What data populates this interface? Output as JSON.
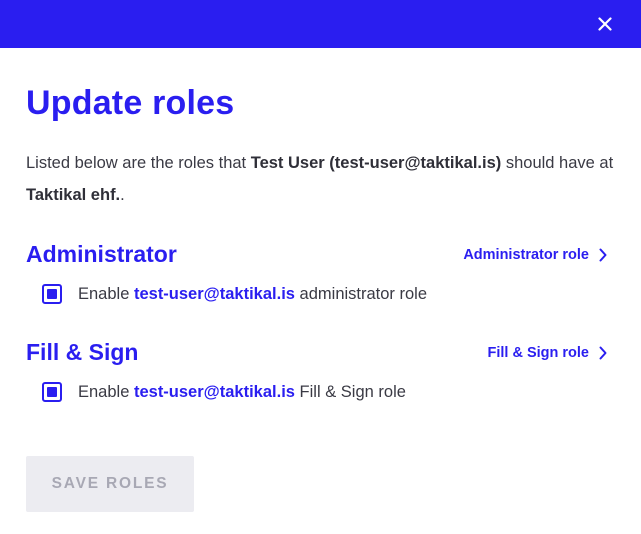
{
  "dialog": {
    "title": "Update roles",
    "description": {
      "prefix": "Listed below are the roles that ",
      "user": "Test User (test-user@taktikal.is)",
      "middle": " should have at ",
      "company": "Taktikal ehf.",
      "suffix": "."
    }
  },
  "roles": [
    {
      "heading": "Administrator",
      "link_label": "Administrator role",
      "checked": true,
      "option_prefix": "Enable ",
      "email": "test-user@taktikal.is",
      "option_suffix": " administrator role"
    },
    {
      "heading": "Fill & Sign",
      "link_label": "Fill & Sign role",
      "checked": true,
      "option_prefix": "Enable ",
      "email": "test-user@taktikal.is",
      "option_suffix": " Fill & Sign role"
    }
  ],
  "actions": {
    "save_label": "SAVE ROLES"
  },
  "icons": {
    "close": "close-icon",
    "chevron": "chevron-right-icon"
  },
  "colors": {
    "primary": "#2a1ef0",
    "button_disabled_bg": "#ececf1",
    "button_disabled_text": "#a8a8b4"
  }
}
